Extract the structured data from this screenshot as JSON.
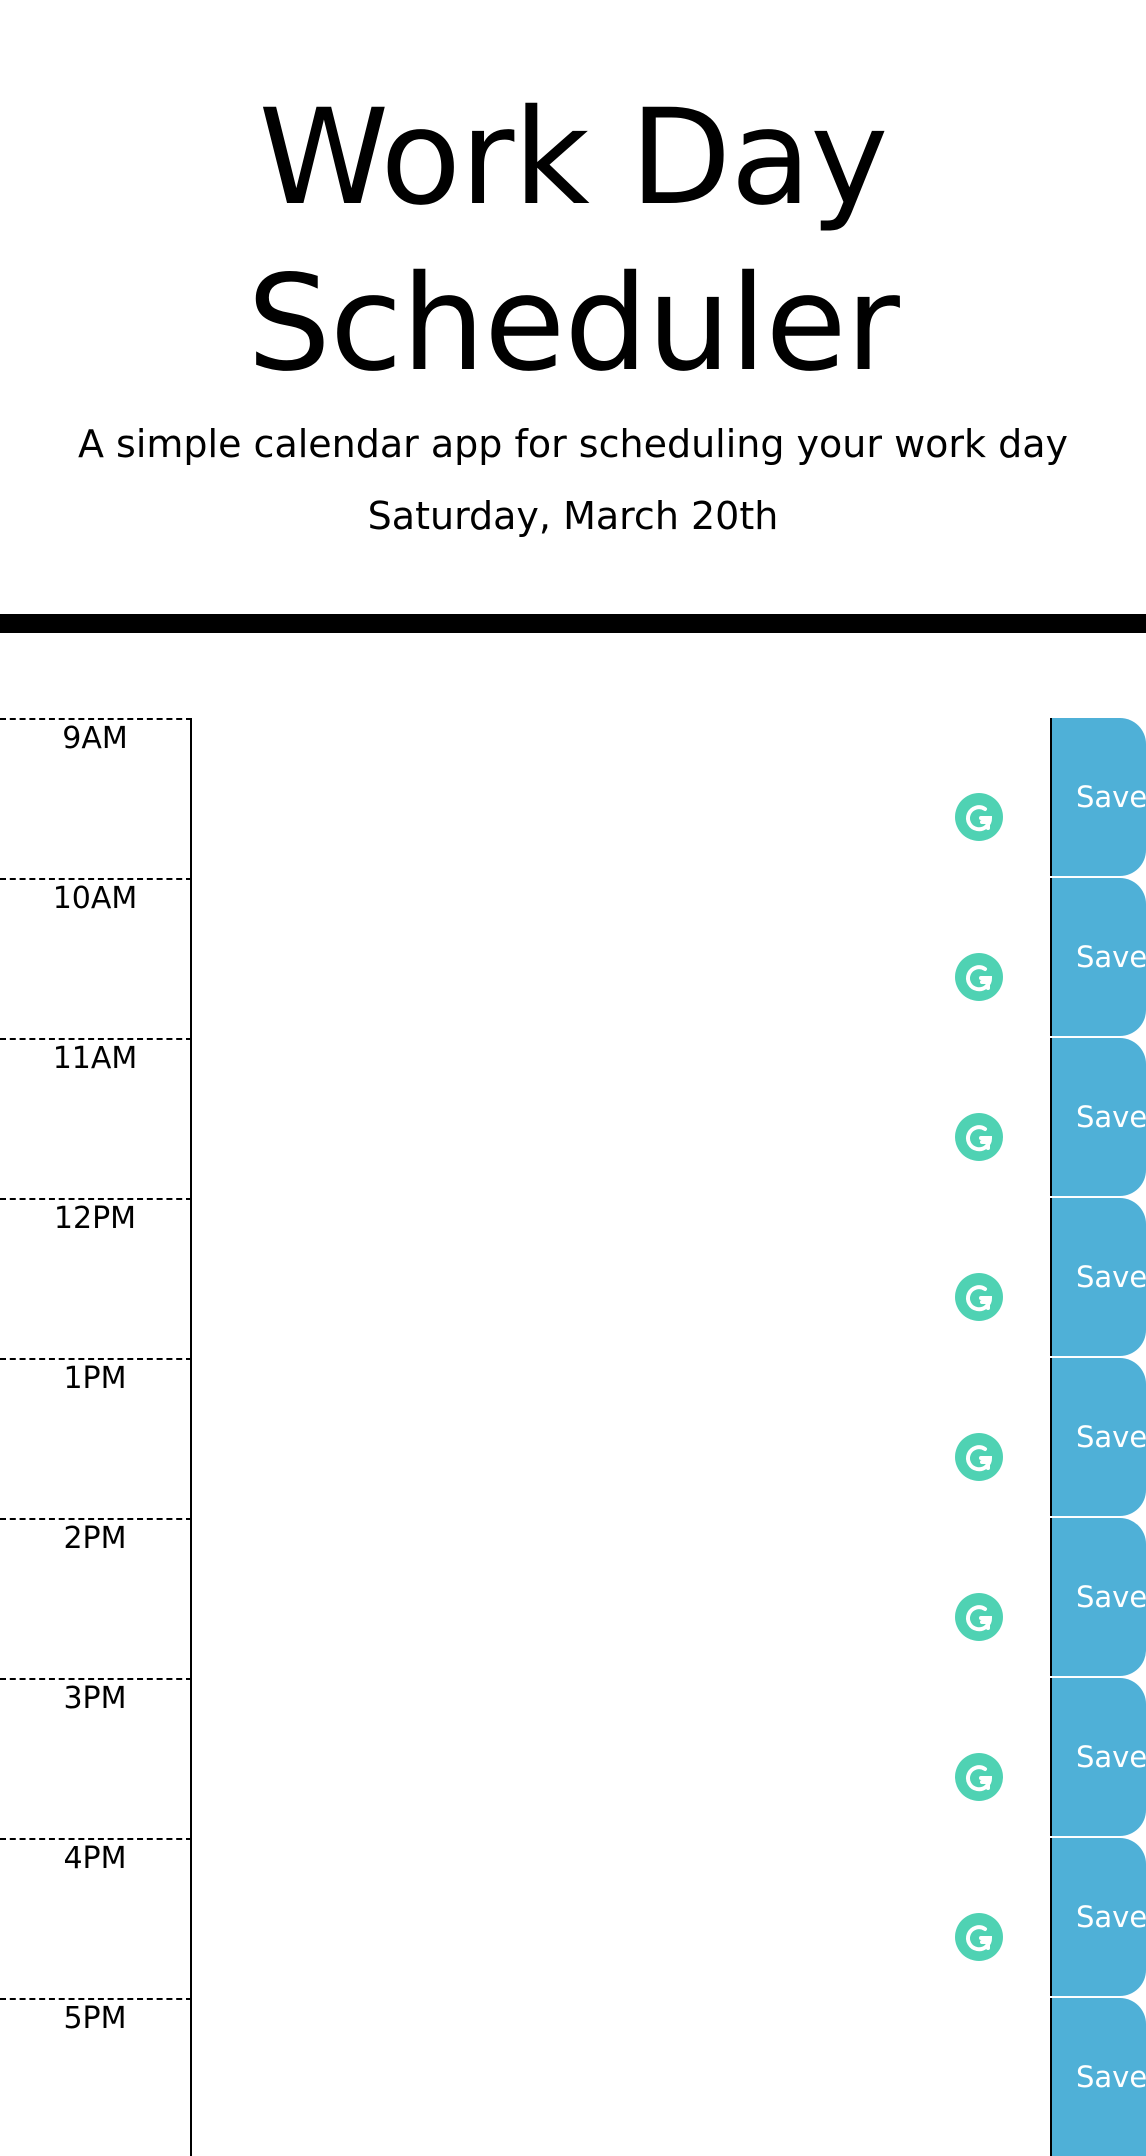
{
  "header": {
    "title_line1": "Work Day",
    "title_line2": "Scheduler",
    "subtitle": "A simple calendar app for scheduling your work day",
    "current_day": "Saturday, March 20th"
  },
  "timeblocks": [
    {
      "hour": "9AM",
      "description": "",
      "save_label": "Save"
    },
    {
      "hour": "10AM",
      "description": "",
      "save_label": "Save"
    },
    {
      "hour": "11AM",
      "description": "",
      "save_label": "Save"
    },
    {
      "hour": "12PM",
      "description": "",
      "save_label": "Save"
    },
    {
      "hour": "1PM",
      "description": "",
      "save_label": "Save"
    },
    {
      "hour": "2PM",
      "description": "",
      "save_label": "Save"
    },
    {
      "hour": "3PM",
      "description": "",
      "save_label": "Save"
    },
    {
      "hour": "4PM",
      "description": "",
      "save_label": "Save"
    },
    {
      "hour": "5PM",
      "description": "",
      "save_label": "Save"
    }
  ],
  "icons": {
    "grammarly": "grammarly-icon"
  },
  "colors": {
    "save_button": "#4fb0d7",
    "grammarly": "#15c39a",
    "divider": "#000000"
  }
}
